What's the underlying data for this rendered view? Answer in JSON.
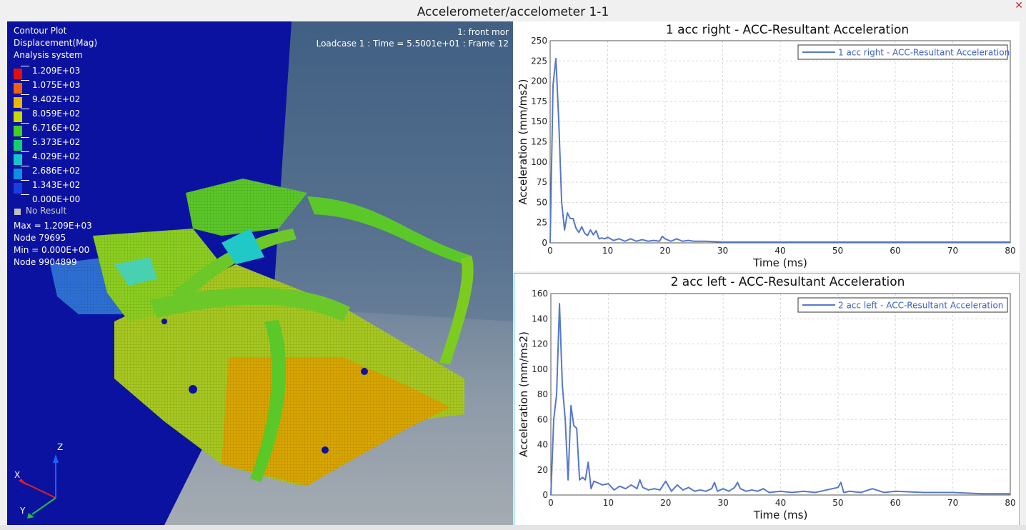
{
  "window": {
    "title": "Accelerometer/accelometer 1-1"
  },
  "viewport": {
    "contour_title": "Contour Plot",
    "contour_type": "Displacement(Mag)",
    "coord_system": "Analysis system",
    "model_name": "1: front mor",
    "loadcase_info": "Loadcase 1 : Time = 5.5001e+01 : Frame 12",
    "legend": [
      {
        "value": "1.209E+03",
        "color": "#e01010"
      },
      {
        "value": "1.075E+03",
        "color": "#f06010"
      },
      {
        "value": "9.402E+02",
        "color": "#e8b800"
      },
      {
        "value": "8.059E+02",
        "color": "#c8d800"
      },
      {
        "value": "6.716E+02",
        "color": "#40d020"
      },
      {
        "value": "5.373E+02",
        "color": "#10d070"
      },
      {
        "value": "4.029E+02",
        "color": "#10c8c8"
      },
      {
        "value": "2.686E+02",
        "color": "#1090e0"
      },
      {
        "value": "1.343E+02",
        "color": "#1840e0"
      },
      {
        "value": "0.000E+00",
        "color": "#0a0aa0"
      }
    ],
    "no_result_label": "No Result",
    "no_result_color": "#c0c0c0",
    "max_label": "Max =  1.209E+03",
    "max_node": "Node 79695",
    "min_label": "Min =  0.000E+00",
    "min_node": "Node 9904899",
    "triad": {
      "x": "X",
      "y": "Y",
      "z": "Z"
    }
  },
  "chart_data": [
    {
      "type": "line",
      "title": "1 acc right - ACC-Resultant Acceleration",
      "xlabel": "Time (ms)",
      "ylabel": "Acceleration (mm/ms2)",
      "xlim": [
        0,
        80
      ],
      "ylim": [
        0,
        250
      ],
      "xticks": [
        0,
        10,
        20,
        30,
        40,
        50,
        60,
        70,
        80
      ],
      "yticks": [
        0,
        25,
        50,
        75,
        100,
        125,
        150,
        175,
        200,
        225,
        250
      ],
      "grid": true,
      "legend_position": "top-right",
      "series": [
        {
          "name": "1 acc right - ACC-Resultant Acceleration",
          "color": "#5577cc",
          "x": [
            0,
            0.5,
            1,
            1.5,
            2,
            2.5,
            3,
            3.5,
            4,
            4.5,
            5,
            5.5,
            6,
            6.5,
            7,
            7.5,
            8,
            8.5,
            9,
            9.5,
            10,
            11,
            12,
            13,
            14,
            15,
            16,
            17,
            18,
            19,
            19.5,
            20,
            21,
            22,
            23,
            24,
            25,
            27,
            30,
            35,
            40,
            45,
            50,
            55,
            60,
            65,
            70,
            75,
            80
          ],
          "y": [
            0,
            195,
            228,
            150,
            50,
            16,
            37,
            30,
            30,
            18,
            13,
            20,
            12,
            9,
            16,
            10,
            15,
            5,
            6,
            5,
            7,
            3,
            5,
            2,
            5,
            2,
            4,
            2,
            3,
            2,
            8,
            5,
            2,
            5,
            2,
            3,
            2,
            2,
            1,
            1,
            1,
            1,
            1,
            1,
            1,
            1,
            1,
            1,
            1
          ]
        }
      ]
    },
    {
      "type": "line",
      "title": "2 acc left - ACC-Resultant Acceleration",
      "xlabel": "Time (ms)",
      "ylabel": "Acceleration (mm/ms2)",
      "xlim": [
        0,
        80
      ],
      "ylim": [
        0,
        160
      ],
      "xticks": [
        0,
        10,
        20,
        30,
        40,
        50,
        60,
        70,
        80
      ],
      "yticks": [
        0,
        20,
        40,
        60,
        80,
        100,
        120,
        140,
        160
      ],
      "grid": true,
      "legend_position": "top-right",
      "series": [
        {
          "name": "2 acc left - ACC-Resultant Acceleration",
          "color": "#5577cc",
          "x": [
            0,
            0.5,
            1,
            1.5,
            2,
            2.5,
            3,
            3.5,
            4,
            4.5,
            5,
            5.5,
            6,
            6.5,
            7,
            7.5,
            8,
            9,
            10,
            11,
            12,
            13,
            14,
            15,
            15.5,
            16,
            17,
            18,
            19,
            20,
            21,
            22,
            23,
            24,
            25,
            26,
            27,
            28,
            28.5,
            29,
            30,
            31,
            32,
            32.5,
            33,
            34,
            35,
            36,
            37,
            38,
            40,
            42,
            44,
            46,
            48,
            50,
            50.5,
            51,
            52,
            54,
            56,
            58,
            60,
            65,
            70,
            75,
            80
          ],
          "y": [
            0,
            60,
            80,
            152,
            87,
            60,
            12,
            71,
            55,
            53,
            12,
            14,
            12,
            26,
            5,
            11,
            10,
            8,
            9,
            4,
            7,
            5,
            8,
            5,
            12,
            6,
            4,
            5,
            4,
            11,
            3,
            8,
            4,
            6,
            3,
            4,
            3,
            5,
            10,
            3,
            5,
            3,
            6,
            10,
            5,
            3,
            4,
            3,
            5,
            2,
            3,
            2,
            3,
            2,
            4,
            6,
            10,
            2,
            3,
            2,
            5,
            2,
            3,
            2,
            2,
            1,
            1
          ]
        }
      ]
    }
  ]
}
